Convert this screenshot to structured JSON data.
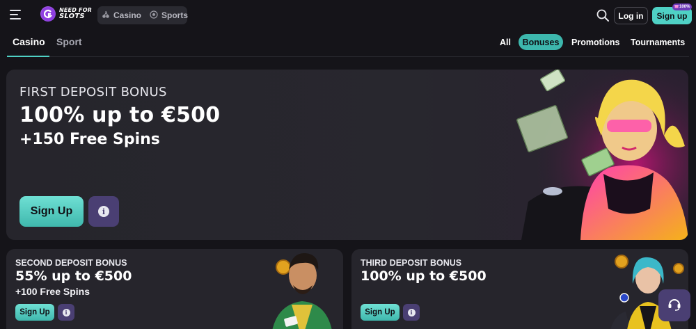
{
  "header": {
    "logo_line1": "NEED FOR",
    "logo_line2": "SLOTS",
    "modes": [
      {
        "label": "Casino",
        "icon": "cherry-icon"
      },
      {
        "label": "Sports",
        "icon": "soccer-ball-icon"
      }
    ],
    "login_label": "Log in",
    "signup_label": "Sign up",
    "signup_badge": "100%"
  },
  "tabs": {
    "main": [
      {
        "label": "Casino",
        "active": true
      },
      {
        "label": "Sport",
        "active": false
      }
    ],
    "filters": [
      {
        "label": "All",
        "active": false
      },
      {
        "label": "Bonuses",
        "active": true
      },
      {
        "label": "Promotions",
        "active": false
      },
      {
        "label": "Tournaments",
        "active": false
      }
    ]
  },
  "hero": {
    "title": "FIRST DEPOSIT BONUS",
    "offer": "100% up to €500",
    "extra": "+150 Free Spins",
    "signup_label": "Sign Up"
  },
  "cards": [
    {
      "title": "SECOND DEPOSIT BONUS",
      "offer": "55% up to €500",
      "extra": "+100 Free Spins",
      "signup_label": "Sign Up"
    },
    {
      "title": "THIRD DEPOSIT BONUS",
      "offer": "100% up to €500",
      "extra": "",
      "signup_label": "Sign Up"
    }
  ],
  "colors": {
    "accent": "#4fd1c5",
    "info_button": "#4a3f73",
    "background": "#151419",
    "card": "#26252c"
  },
  "icons": {
    "menu": "hamburger-menu-icon",
    "search": "search-icon",
    "info": "info-icon",
    "support": "headset-icon"
  }
}
